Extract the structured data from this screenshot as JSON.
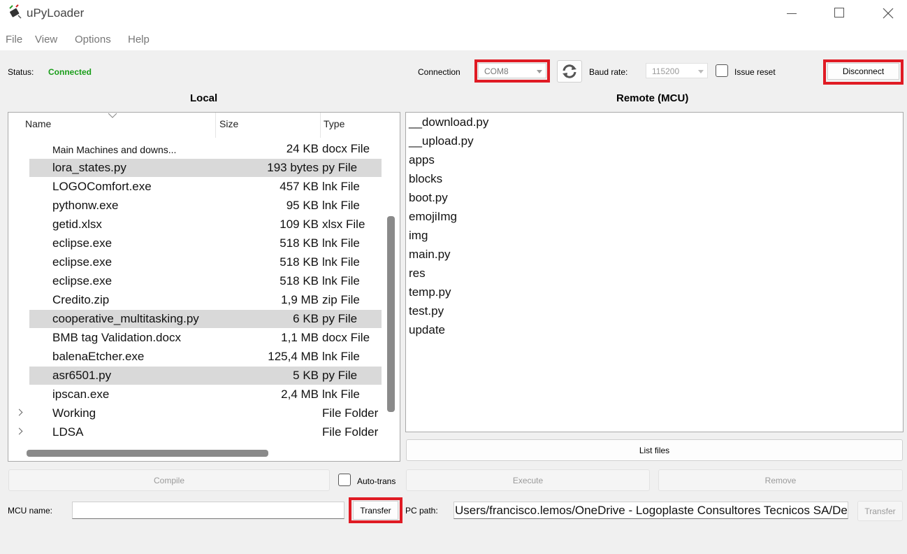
{
  "window": {
    "title": "uPyLoader",
    "icon": "upyloader-chip-icon"
  },
  "menu": [
    "File",
    "View",
    "Options",
    "Help"
  ],
  "status": {
    "label": "Status:",
    "value": "Connected",
    "value_color": "#1a9e1a"
  },
  "connection": {
    "label": "Connection",
    "port": "COM8"
  },
  "baud": {
    "label": "Baud rate:",
    "value": "115200"
  },
  "issue_reset_label": "Issue reset",
  "disconnect_label": "Disconnect",
  "local": {
    "title": "Local",
    "columns": [
      "Name",
      "Size",
      "Type"
    ],
    "files": [
      {
        "name": "Main Machines and downs...",
        "size": "24 KB",
        "type": "docx File",
        "selected": false
      },
      {
        "name": "lora_states.py",
        "size": "193 bytes",
        "type": "py File",
        "selected": true
      },
      {
        "name": "LOGOComfort.exe",
        "size": "457 KB",
        "type": "lnk File",
        "selected": false
      },
      {
        "name": "pythonw.exe",
        "size": "95 KB",
        "type": "lnk File",
        "selected": false
      },
      {
        "name": "getid.xlsx",
        "size": "109 KB",
        "type": "xlsx File",
        "selected": false
      },
      {
        "name": "eclipse.exe",
        "size": "518 KB",
        "type": "lnk File",
        "selected": false
      },
      {
        "name": "eclipse.exe",
        "size": "518 KB",
        "type": "lnk File",
        "selected": false
      },
      {
        "name": "eclipse.exe",
        "size": "518 KB",
        "type": "lnk File",
        "selected": false
      },
      {
        "name": "Credito.zip",
        "size": "1,9 MB",
        "type": "zip File",
        "selected": false
      },
      {
        "name": "cooperative_multitasking.py",
        "size": "6 KB",
        "type": "py File",
        "selected": true
      },
      {
        "name": "BMB tag Validation.docx",
        "size": "1,1 MB",
        "type": "docx File",
        "selected": false
      },
      {
        "name": "balenaEtcher.exe",
        "size": "125,4 MB",
        "type": "lnk File",
        "selected": false
      },
      {
        "name": "asr6501.py",
        "size": "5 KB",
        "type": "py File",
        "selected": true
      },
      {
        "name": "ipscan.exe",
        "size": "2,4 MB",
        "type": "lnk File",
        "selected": false
      },
      {
        "name": "Working",
        "size": "",
        "type": "File Folder",
        "selected": false,
        "folder": true
      },
      {
        "name": "LDSA",
        "size": "",
        "type": "File Folder",
        "selected": false,
        "folder": true
      }
    ]
  },
  "remote": {
    "title": "Remote (MCU)",
    "files": [
      "__download.py",
      "__upload.py",
      "apps",
      "blocks",
      "boot.py",
      "emojiImg",
      "img",
      "main.py",
      "res",
      "temp.py",
      "test.py",
      "update"
    ]
  },
  "buttons": {
    "list_files": "List files",
    "compile": "Compile",
    "auto_transfer": "Auto-trans",
    "execute": "Execute",
    "remove": "Remove",
    "transfer_left": "Transfer",
    "transfer_right": "Transfer"
  },
  "mcu_name": {
    "label": "MCU name:",
    "value": ""
  },
  "pc_path": {
    "label": "PC path:",
    "value": "Users/francisco.lemos/OneDrive - Logoplaste Consultores Tecnicos SA/Desktop"
  },
  "highlight_color": "#e01b24"
}
